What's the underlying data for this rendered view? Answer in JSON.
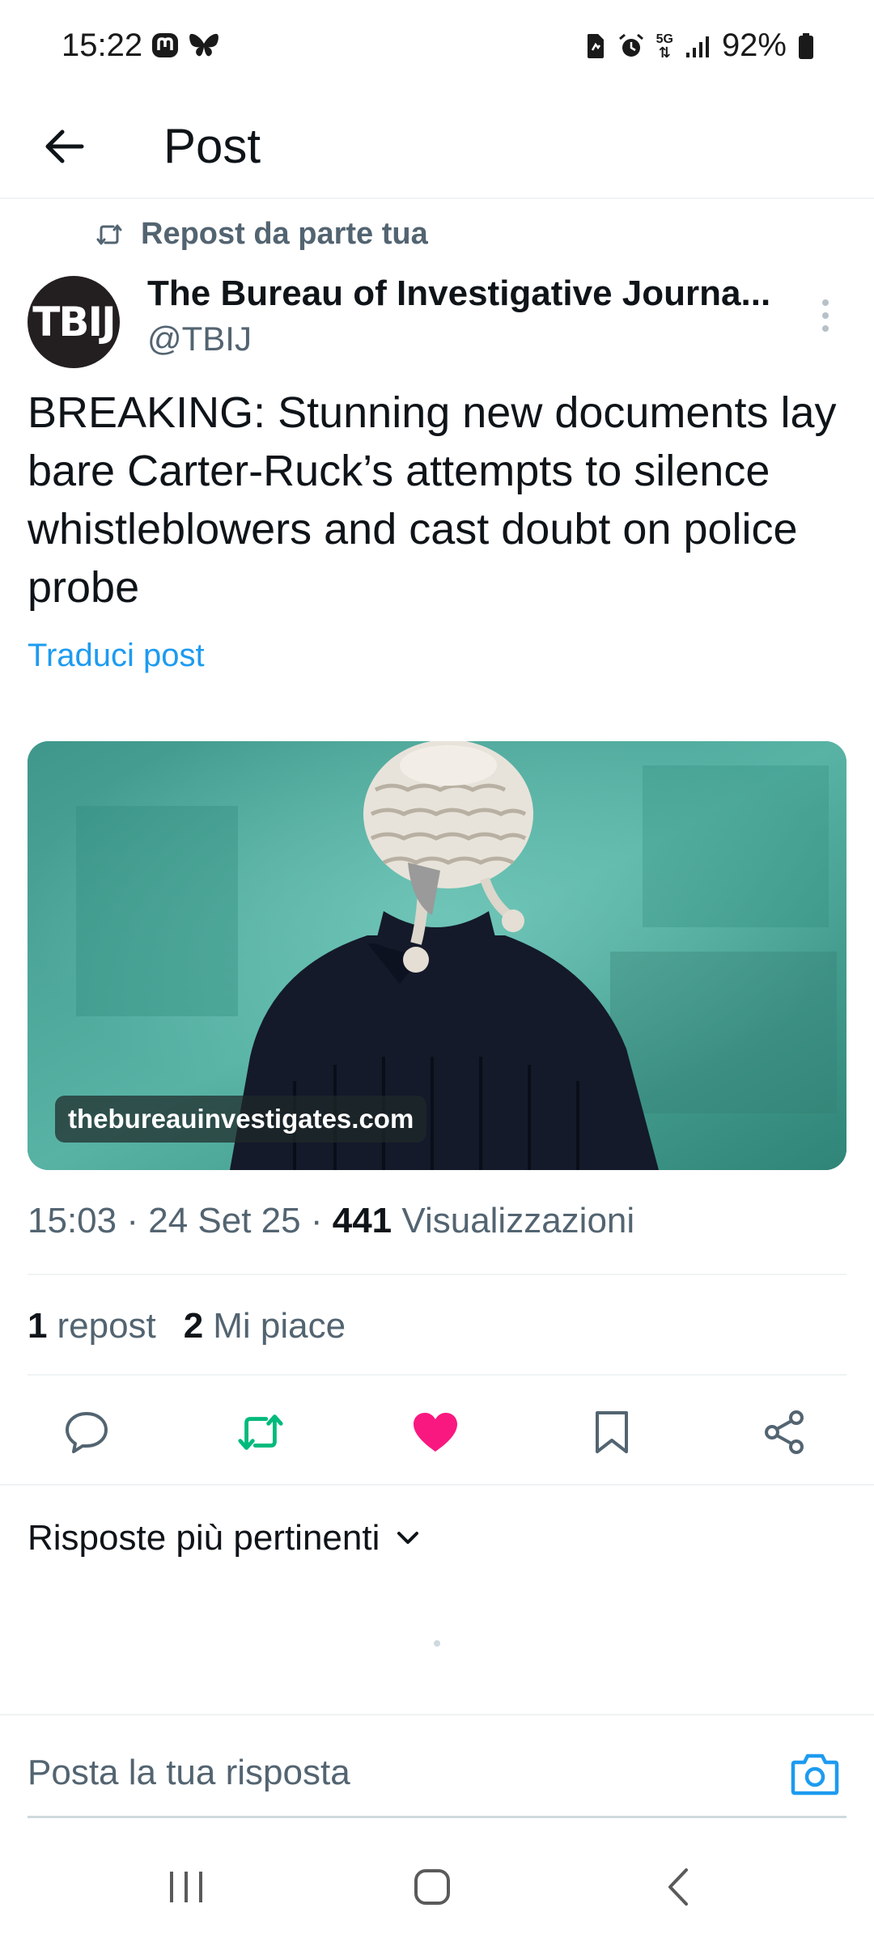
{
  "status_bar": {
    "time": "15:22",
    "network": "5G",
    "battery": "92%"
  },
  "header": {
    "title": "Post"
  },
  "repost_indicator": {
    "label": "Repost da parte tua"
  },
  "author": {
    "avatar_text": "TBIJ",
    "name": "The Bureau of Investigative Journa...",
    "handle": "@TBIJ"
  },
  "post": {
    "text": "BREAKING: Stunning new documents lay bare Carter-Ruck’s attempts to silence whistleblowers and cast doubt on police probe",
    "translate_label": "Traduci post",
    "media_domain": "thebureauinvestigates.com",
    "time": "15:03",
    "date": "24 Set 25",
    "views_count": "441",
    "views_label": "Visualizzazioni",
    "separator": "·"
  },
  "stats": {
    "reposts_count": "1",
    "reposts_label": "repost",
    "likes_count": "2",
    "likes_label": "Mi piace"
  },
  "actions": {
    "reply_icon": "reply-icon",
    "repost_icon": "repost-icon",
    "like_icon": "heart-icon",
    "bookmark_icon": "bookmark-icon",
    "share_icon": "share-icon",
    "repost_color": "#00ba7c",
    "like_color": "#f91880"
  },
  "replies": {
    "sort_label": "Risposte più pertinenti"
  },
  "reply_bar": {
    "placeholder": "Posta la tua risposta"
  },
  "colors": {
    "accent": "#1d9bf0",
    "secondary_text": "#536471",
    "media_bg": "#3f9e90"
  }
}
